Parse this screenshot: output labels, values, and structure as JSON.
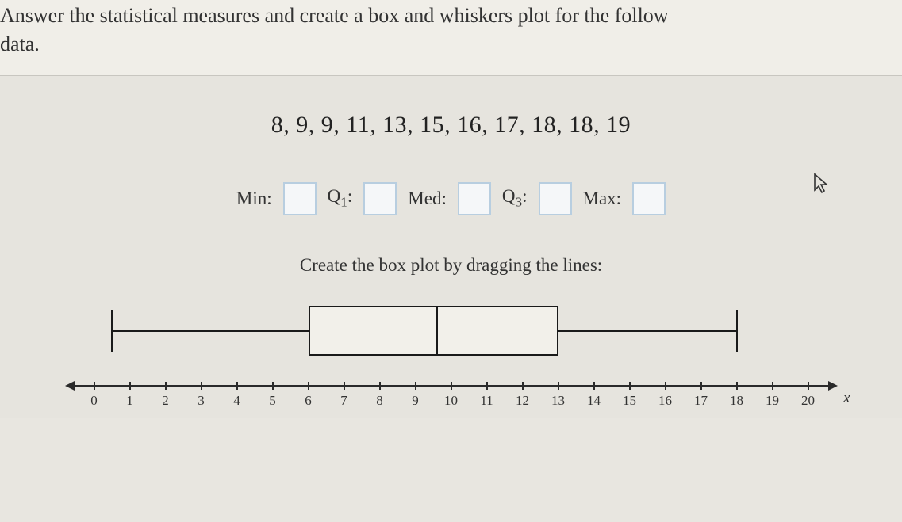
{
  "instruction_line1": "Answer the statistical measures and create a box and whiskers plot for the follow",
  "instruction_line2": "data.",
  "data_string": "8, 9, 9, 11, 13, 15, 16, 17, 18, 18, 19",
  "measures": {
    "min_label": "Min:",
    "q1_label_pre": "Q",
    "q1_label_sub": "1",
    "q1_label_post": ":",
    "med_label": "Med:",
    "q3_label_pre": "Q",
    "q3_label_sub": "3",
    "q3_label_post": ":",
    "max_label": "Max:",
    "min_value": "",
    "q1_value": "",
    "med_value": "",
    "q3_value": "",
    "max_value": ""
  },
  "drag_instruction": "Create the box plot by dragging the lines:",
  "axis": {
    "ticks": [
      "0",
      "1",
      "2",
      "3",
      "4",
      "5",
      "6",
      "7",
      "8",
      "9",
      "10",
      "11",
      "12",
      "13",
      "14",
      "15",
      "16",
      "17",
      "18",
      "19",
      "20"
    ],
    "x_label": "x"
  },
  "chart_data": {
    "type": "boxplot",
    "title": "",
    "xlabel": "x",
    "ylabel": "",
    "xlim": [
      0,
      20
    ],
    "current_positions": {
      "min": 0.5,
      "q1": 6,
      "median": 9.6,
      "q3": 13,
      "max": 18
    },
    "underlying_data": [
      8,
      9,
      9,
      11,
      13,
      15,
      16,
      17,
      18,
      18,
      19
    ]
  }
}
